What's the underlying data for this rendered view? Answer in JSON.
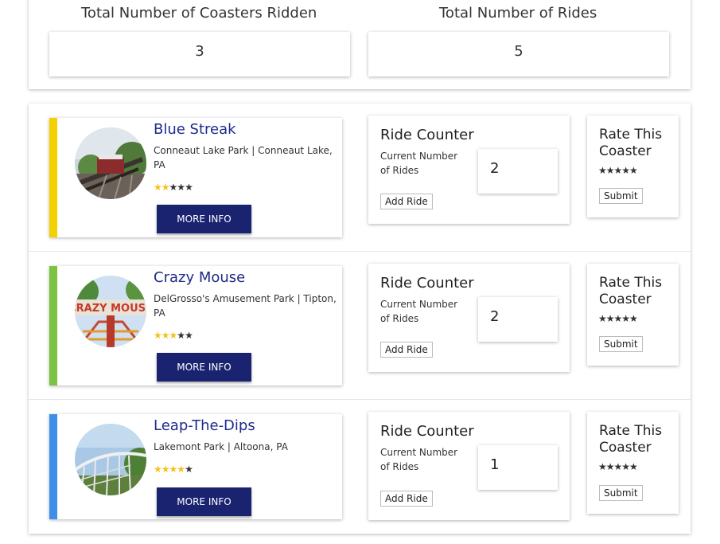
{
  "totals": {
    "coasters_label": "Total Number of Coasters Ridden",
    "coasters_value": "3",
    "rides_label": "Total Number of Rides",
    "rides_value": "5"
  },
  "common": {
    "more_info": "MORE INFO",
    "ride_counter_title": "Ride Counter",
    "current_rides_label": "Current Number of Rides",
    "add_ride": "Add Ride",
    "rate_title": "Rate This Coaster",
    "submit": "Submit",
    "rate_stars": "★★★★★"
  },
  "coasters": [
    {
      "name": "Blue Streak",
      "park": "Conneaut Lake Park | Conneaut Lake, PA",
      "rating": 2,
      "rating_max": 5,
      "ride_count": "2",
      "accent_color": "#f5d000",
      "photo_icon": "roller-coaster-photo"
    },
    {
      "name": "Crazy Mouse",
      "park": "DelGrosso's Amusement Park | Tipton, PA",
      "rating": 3,
      "rating_max": 5,
      "ride_count": "2",
      "accent_color": "#7cc243",
      "photo_icon": "crazy-mouse-sign-photo",
      "photo_sign_text": "CRAZY MOUSE"
    },
    {
      "name": "Leap-The-Dips",
      "park": "Lakemont Park | Altoona, PA",
      "rating": 4,
      "rating_max": 5,
      "ride_count": "1",
      "accent_color": "#3d8fe8",
      "photo_icon": "wooden-coaster-photo"
    }
  ],
  "colors": {
    "button_bg": "#1a2370",
    "name_text": "#1f2a8c",
    "star_filled": "#f2c21b"
  }
}
